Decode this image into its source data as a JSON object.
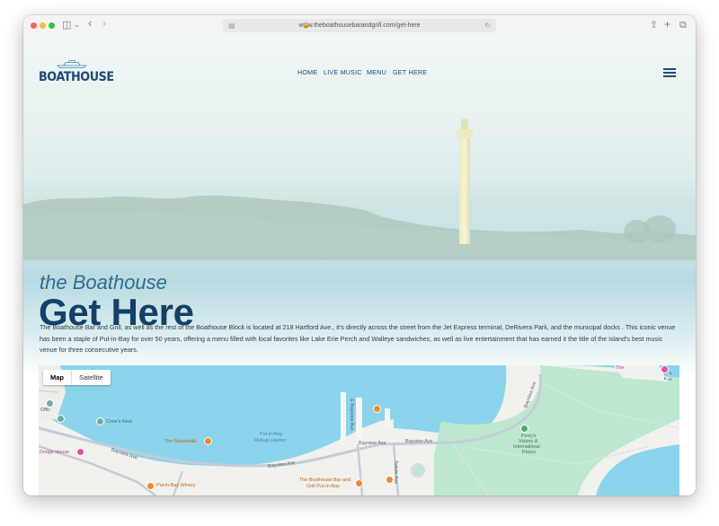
{
  "browser": {
    "url": "www.theboathousebarandgrill.com/get-here",
    "traffic_lights": [
      "#fe5f57",
      "#febc2e",
      "#28c840"
    ]
  },
  "site": {
    "logo_text": "BOATHOUSE",
    "nav": [
      "HOME",
      "LIVE MUSIC",
      "MENU",
      "GET HERE"
    ]
  },
  "hero": {
    "subtitle": "the Boathouse",
    "title": "Get Here"
  },
  "description": "The Boathouse Bar and Grill, as well as the rest of the Boathouse Block is located at 218 Hartford Ave., it's directly across the street from the Jet Express terminal, DeRivera Park, and the municipal docks . This iconic venue has been a staple of Put-in-Bay for over 50 years, offering a menu filled with local favorites like Lake Erie Perch and Walleye sandwiches, as well as live entertainment that has earned it the title of the island's best music venue for three consecutive years.",
  "map": {
    "type_buttons": [
      "Map",
      "Satellite"
    ],
    "selected": "Map",
    "labels": {
      "crews_nest": "Crew's Nest",
      "boardwalk": "The Boardwalk",
      "harbor_line1": "Put-in-Bay",
      "harbor_line2": "Refuge Harbor",
      "dodge_house": "Dodge House",
      "bayview_west": "Bayview Ave",
      "bayview_mid": "Bayview Ave",
      "bayview_east1": "Bayview Ave",
      "bayview_east2": "Bayview Ave",
      "bayview_ave_vertical": "E Bayview Ave",
      "toledo_ave": "Toledo Ave",
      "winery": "Put-in-Bay Winery",
      "boathouse_line1": "The Boathouse Bar and",
      "boathouse_line2": "Grill-Put-In-Bay",
      "perrys_line1": "Perry's",
      "perrys_line2": "Victory &",
      "perrys_line3": "International",
      "perrys_line4": "Peace",
      "edge_label": "Offic",
      "top_right_label": "The"
    }
  }
}
